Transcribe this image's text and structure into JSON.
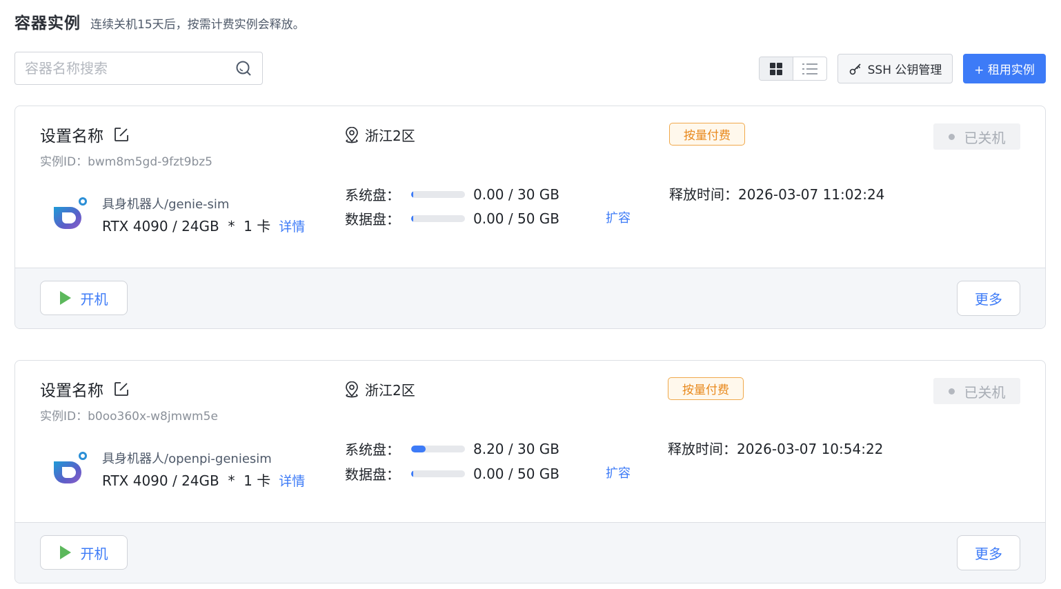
{
  "header": {
    "title": "容器实例",
    "note": "连续关机15天后，按需计费实例会释放。"
  },
  "toolbar": {
    "search_placeholder": "容器名称搜索",
    "ssh_label": "SSH 公钥管理",
    "rent_label": "+ 租用实例",
    "view_modes": [
      "grid-icon",
      "list-icon"
    ],
    "active_view": "grid"
  },
  "colors": {
    "primary": "#3d7bf7",
    "billing": "#e8891d",
    "start_icon": "#5cb85c"
  },
  "instances": [
    {
      "name": "设置名称",
      "id_text": "实例ID：bwm8m5gd-9fzt9bz5",
      "image": "具身机器人/genie-sim",
      "gpu": "RTX 4090 / 24GB  *  1 卡",
      "detail_label": "详情",
      "region": "浙江2区",
      "sys_disk_label": "系统盘：",
      "sys_disk_value": "0.00 / 30 GB",
      "sys_disk_fraction": 0.0,
      "data_disk_label": "数据盘：",
      "data_disk_value": "0.00 / 50 GB",
      "data_disk_fraction": 0.0,
      "expand_label": "扩容",
      "billing": "按量付费",
      "release": "释放时间：2026-03-07 11:02:24",
      "status": "已关机",
      "start_label": "开机",
      "more_label": "更多"
    },
    {
      "name": "设置名称",
      "id_text": "实例ID：b0oo360x-w8jmwm5e",
      "image": "具身机器人/openpi-geniesim",
      "gpu": "RTX 4090 / 24GB  *  1 卡",
      "detail_label": "详情",
      "region": "浙江2区",
      "sys_disk_label": "系统盘：",
      "sys_disk_value": "8.20 / 30 GB",
      "sys_disk_fraction": 0.273,
      "data_disk_label": "数据盘：",
      "data_disk_value": "0.00 / 50 GB",
      "data_disk_fraction": 0.0,
      "expand_label": "扩容",
      "billing": "按量付费",
      "release": "释放时间：2026-03-07 10:54:22",
      "status": "已关机",
      "start_label": "开机",
      "more_label": "更多"
    }
  ]
}
